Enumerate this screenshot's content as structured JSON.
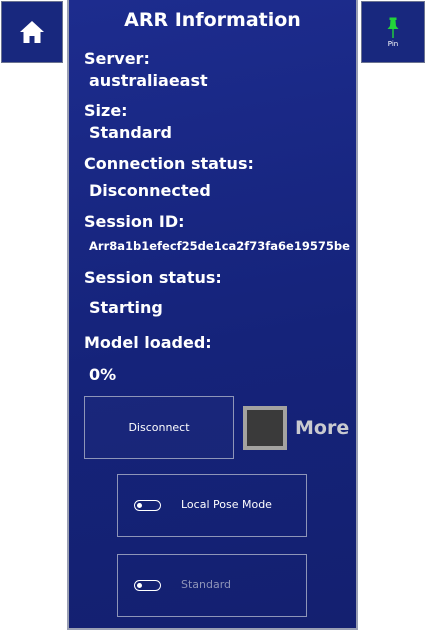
{
  "home_button": {
    "icon": "home-icon"
  },
  "pin_button": {
    "label": "Pin",
    "icon": "pushpin-icon",
    "icon_color": "#22d33a"
  },
  "panel": {
    "title": "ARR Information",
    "server_label": "Server:",
    "server_value": "australiaeast",
    "size_label": "Size:",
    "size_value": "Standard",
    "connection_label": "Connection status:",
    "connection_value": "Disconnected",
    "session_id_label": "Session ID:",
    "session_id_value": "Arr8a1b1efecf25de1ca2f73fa6e19575be",
    "session_status_label": "Session status:",
    "session_status_value": "Starting",
    "model_loaded_label": "Model loaded:",
    "model_loaded_value": "0%"
  },
  "actions": {
    "disconnect_label": "Disconnect",
    "more_label": "More"
  },
  "toggles": {
    "local_pose_label": "Local Pose Mode",
    "standard_label": "Standard"
  },
  "colors": {
    "panel_background": "#18287e",
    "border": "#9a9fb3"
  }
}
